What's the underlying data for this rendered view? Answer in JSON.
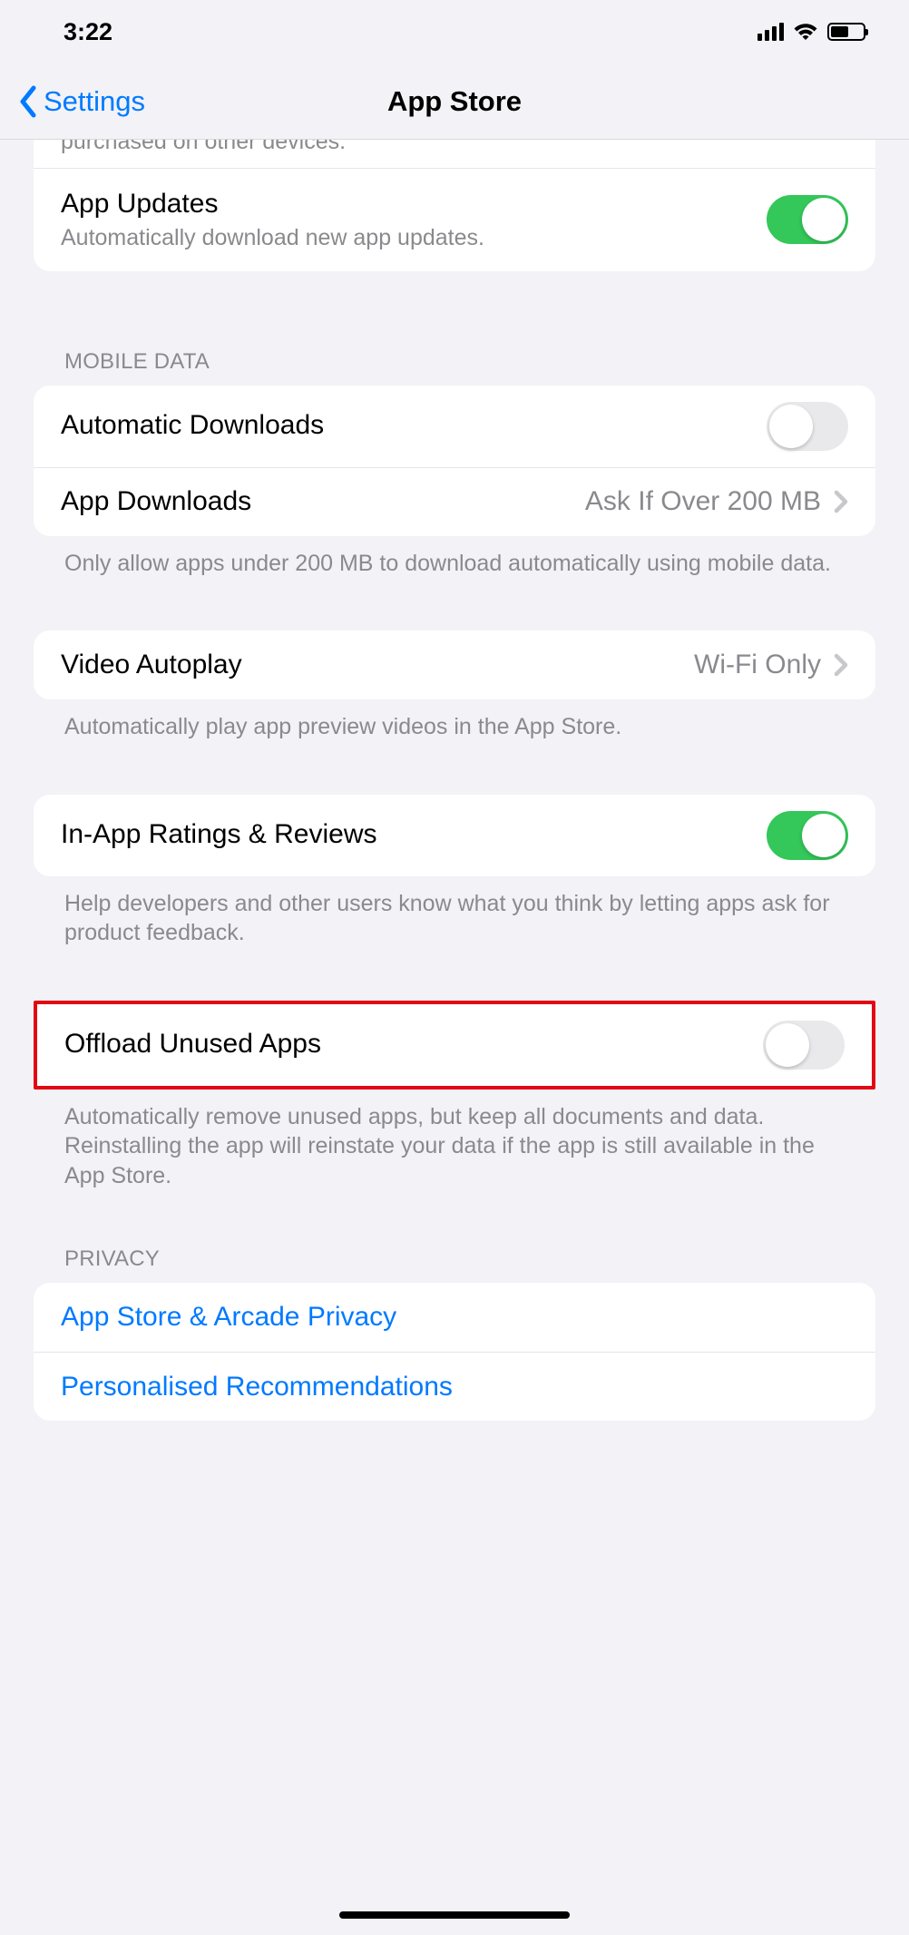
{
  "status": {
    "time": "3:22"
  },
  "nav": {
    "back_label": "Settings",
    "title": "App Store"
  },
  "top_partial": {
    "subtitle": "purchased on other devices."
  },
  "app_updates": {
    "title": "App Updates",
    "subtitle": "Automatically download new app updates.",
    "on": true
  },
  "mobile_data": {
    "header": "MOBILE DATA",
    "auto_downloads": {
      "title": "Automatic Downloads",
      "on": false
    },
    "app_downloads": {
      "title": "App Downloads",
      "value": "Ask If Over 200 MB"
    },
    "footer": "Only allow apps under 200 MB to download automatically using mobile data."
  },
  "video_autoplay": {
    "title": "Video Autoplay",
    "value": "Wi-Fi Only",
    "footer": "Automatically play app preview videos in the App Store."
  },
  "ratings": {
    "title": "In-App Ratings & Reviews",
    "on": true,
    "footer": "Help developers and other users know what you think by letting apps ask for product feedback."
  },
  "offload": {
    "title": "Offload Unused Apps",
    "on": false,
    "footer": "Automatically remove unused apps, but keep all documents and data. Reinstalling the app will reinstate your data if the app is still available in the App Store."
  },
  "privacy": {
    "header": "PRIVACY",
    "item1": "App Store & Arcade Privacy",
    "item2": "Personalised Recommendations"
  }
}
